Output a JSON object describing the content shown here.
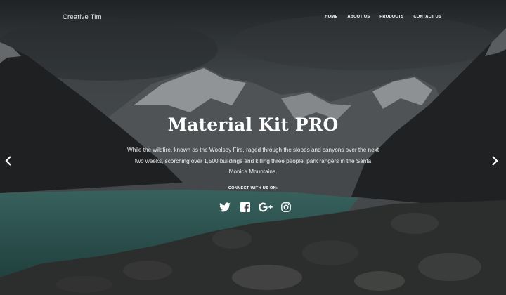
{
  "navbar": {
    "brand": "Creative Tim",
    "links": [
      "HOME",
      "ABOUT US",
      "PRODUCTS",
      "CONTACT US"
    ]
  },
  "hero": {
    "title": "Material Kit PRO",
    "description": "While the wildfire, known as the Woolsey Fire, raged through the slopes and canyons over the next two weeks, scorching over 1,500 buildings and killing three people, park rangers in the Santa Monica Mountains.",
    "connect_label": "CONNECT WITH US ON:",
    "socials": [
      "twitter-icon",
      "facebook-icon",
      "google-plus-icon",
      "instagram-icon"
    ]
  },
  "carousel": {
    "prev_icon": "chevron-left-icon",
    "next_icon": "chevron-right-icon"
  },
  "colors": {
    "sky": "#4f5559",
    "lake": "#4f8d87",
    "text": "#ffffff"
  }
}
